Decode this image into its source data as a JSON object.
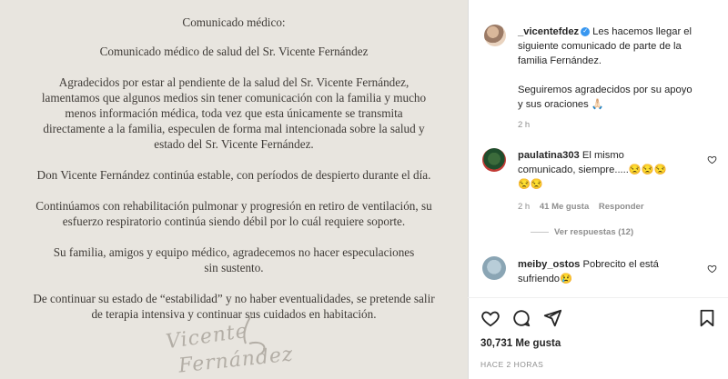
{
  "statement": {
    "heading": "Comunicado médico:",
    "subheading": "Comunicado médico de salud del Sr. Vicente Fernández",
    "para1": [
      "Agradecidos por estar al pendiente de la salud del Sr. Vicente Fernández,",
      "lamentamos que algunos medios sin tener comunicación con la familia y mucho",
      "menos información médica, toda vez que esta únicamente se transmita",
      "directamente a la familia, especulen de forma mal intencionada sobre la salud y",
      "estado del Sr. Vicente Fernández."
    ],
    "para2": "Don Vicente Fernández continúa estable, con períodos de despierto durante el día.",
    "para3": [
      "Continúamos con rehabilitación pulmonar y progresión en retiro de ventilación, su",
      "esfuerzo respiratorio continúa siendo débil por lo cuál requiere soporte."
    ],
    "para4": [
      "Su familia, amigos y equipo médico, agradecemos no hacer especulaciones",
      "sin sustento."
    ],
    "para5": [
      "De continuar su estado de “estabilidad” y no haber eventualidades, se pretende salir",
      "de terapia intensiva y continuar sus cuidados en habitación."
    ],
    "signature": [
      "Vicente",
      "Fernández"
    ]
  },
  "caption": {
    "username": "_vicentefdez",
    "lines": [
      "Les hacemos llegar el",
      "siguiente comunicado de parte de la",
      "familia Fernández."
    ],
    "lines2": [
      "Seguiremos agradecidos por su apoyo",
      "y sus oraciones 🙏🏻"
    ],
    "time": "2 h"
  },
  "comments": [
    {
      "username": "paulatina303",
      "text_line1": "El mismo",
      "text_line2": "comunicado, siempre.....😒😒😒",
      "text_line3": "😒😒",
      "time": "2 h",
      "likes": "41 Me gusta",
      "reply": "Responder",
      "view_replies": "Ver respuestas (12)"
    },
    {
      "username": "meiby_ostos",
      "text_line1": "Pobrecito el está",
      "text_line2": "sufriendo😢"
    }
  ],
  "footer": {
    "likes": "30,731 Me gusta",
    "time": "HACE 2 HORAS"
  },
  "icons": [
    "heart-icon",
    "comment-icon",
    "share-icon",
    "bookmark-icon",
    "verified-icon"
  ],
  "colors": {
    "verified": "#3897f0",
    "paper": "#e8e5df",
    "muted": "#8e8e8e"
  }
}
